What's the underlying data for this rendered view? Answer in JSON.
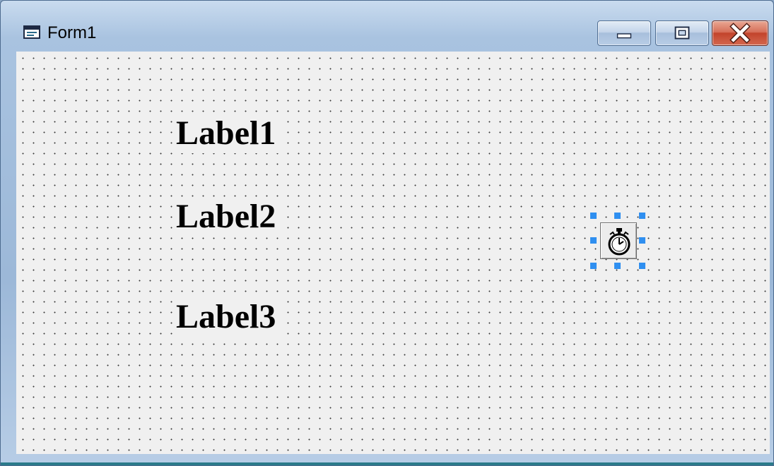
{
  "window": {
    "title": "Form1",
    "icon": "form-icon",
    "controls": {
      "minimize": "minimize-icon",
      "maximize": "maximize-icon",
      "close": "close-icon"
    }
  },
  "form": {
    "labels": [
      "Label1",
      "Label2",
      "Label3"
    ],
    "timer_icon": "stopwatch-icon",
    "selection_color": "#2f8ff0"
  },
  "colors": {
    "client_background": "#f0f0f0",
    "close_button": "#c2442c",
    "titlebar": "#a9c3e0"
  }
}
